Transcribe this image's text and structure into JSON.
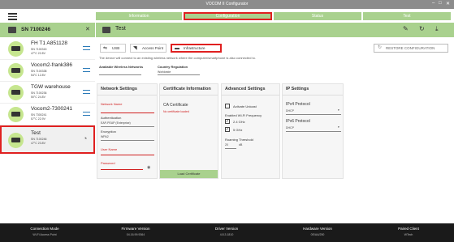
{
  "window": {
    "title": "VOCOM II Configurator"
  },
  "nav_tabs": [
    {
      "label": "Information"
    },
    {
      "label": "Configuration"
    },
    {
      "label": "Status"
    },
    {
      "label": "Test"
    }
  ],
  "device_header": {
    "label": "SN 7100246"
  },
  "devices": [
    {
      "name": "FH T1 A851128",
      "sn": "SN 7100315",
      "stats": "47°C  22.8V"
    },
    {
      "name": "Vocom2-frank386",
      "sn": "SN 7100338",
      "stats": "54°C  12.8V"
    },
    {
      "name": "TGW warehouse",
      "sn": "SN 7100236",
      "stats": "50°C  24.8V"
    },
    {
      "name": "Vocom2-7300241",
      "sn": "SN 7300241",
      "stats": "57°C  22.9V"
    },
    {
      "name": "Test",
      "sn": "SN 7100246",
      "stats": "47°C  23.8V"
    }
  ],
  "main_header": {
    "label": "Test"
  },
  "mode_buttons": [
    {
      "label": "USB"
    },
    {
      "label": "Access Point"
    },
    {
      "label": "Infrastructure"
    }
  ],
  "restore_label": "RESTORE CONFIGURATION",
  "description": "The device will connect to an existing wireless network where the computer/smartphone is also connected to.",
  "available_networks": {
    "label": "Available Wireless Networks",
    "value": ""
  },
  "country_regulation": {
    "label": "Country Regulation",
    "value": "Worldwide"
  },
  "network_settings": {
    "title": "Network Settings",
    "network_name_label": "Network Name",
    "authentication_label": "Authentication",
    "authentication_value": "EAP-PEAP (Enterprise)",
    "encryption_label": "Encryption",
    "encryption_value": "WPA2",
    "username_label": "User Name",
    "password_label": "Password"
  },
  "certificate": {
    "title": "Certificate Information",
    "ca_label": "CA Certificate",
    "ca_status": "No certificate loaded",
    "load_label": "Load Certificate"
  },
  "advanced": {
    "title": "Advanced Settings",
    "activate_unicast": "Activate Unicast",
    "freq_label": "Enabled Wi-Fi Frequency",
    "freq_24": "2.4 GHz",
    "freq_5": "5 GHz",
    "roaming_label": "Roaming Threshold",
    "roaming_value": "20",
    "roaming_unit": "dB"
  },
  "ip": {
    "title": "IP Settings",
    "ipv4_label": "IPv4 Protocol",
    "ipv4_value": "DHCP",
    "ipv6_label": "IPv6 Protocol",
    "ipv6_value": "DHCP"
  },
  "footer": [
    {
      "head": "Connection Mode",
      "value": "Wi-Fi Access Point"
    },
    {
      "head": "Firmware Version",
      "value": "04.16.99.9364"
    },
    {
      "head": "Driver Version",
      "value": "4.8.3.1810"
    },
    {
      "head": "Hardware Version",
      "value": "0E/AA/250"
    },
    {
      "head": "Paired Client",
      "value": "WTech"
    }
  ],
  "colors": {
    "accent": "#a9d18e",
    "highlight": "#e02020",
    "footer_bg": "#1a1a1a"
  }
}
